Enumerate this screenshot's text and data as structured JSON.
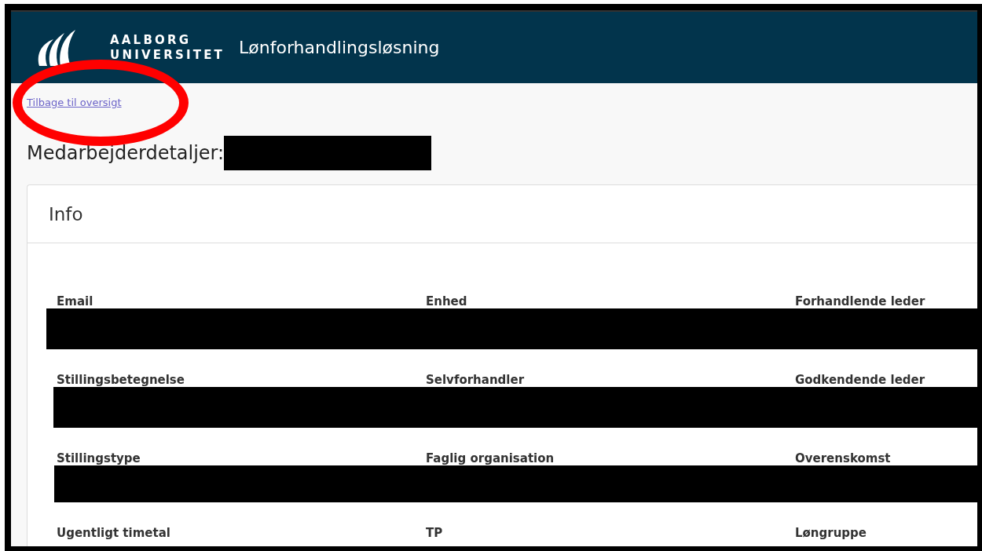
{
  "header": {
    "logo_line_1": "AALBORG",
    "logo_line_2": "UNIVERSITET",
    "app_title": "Lønforhandlingsløsning"
  },
  "back_link": "Tilbage til oversigt",
  "page_title": {
    "text": "Medarbejderdetaljer:",
    "redacted": true
  },
  "card": {
    "title": "Info",
    "rows": [
      {
        "labels": [
          "Email",
          "Enhed",
          "Forhandlende leder"
        ],
        "redacted": true
      },
      {
        "labels": [
          "Stillingsbetegnelse",
          "Selvforhandler",
          "Godkendende leder"
        ],
        "redacted": true
      },
      {
        "labels": [
          "Stillingstype",
          "Faglig organisation",
          "Overenskomst"
        ],
        "redacted": true
      },
      {
        "labels": [
          "Ugentligt timetal",
          "TP",
          "Løngruppe"
        ],
        "redacted": false
      }
    ]
  },
  "annotation": {
    "kind": "ellipse",
    "color": "#ff0000"
  }
}
